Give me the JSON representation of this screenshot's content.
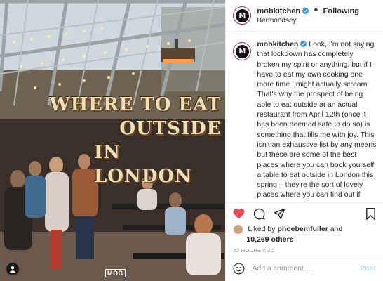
{
  "photo": {
    "headline": [
      "WHERE TO EAT",
      "OUTSIDE",
      "IN LONDON"
    ],
    "watermark": "MOB"
  },
  "header": {
    "username": "mobkitchen",
    "separator": "•",
    "follow_status": "Following",
    "location": "Bermondsey",
    "avatar_letter": "M"
  },
  "caption": {
    "username": "mobkitchen",
    "text": "Look, I'm not saying that lockdown has completely broken my spirit or anything, but if I have to eat my own cooking one more time I might actually scream. That's why the prospect of being able to eat outside at an actual restaurant from April 12th (once it has been deemed safe to do so) is something that fills me with joy. This isn't an exhaustive list by any means but these are some of the best places where you can book yourself a table to eat outside in London this spring – they're the sort of lovely places where you can find out if you've been cat-fished by your lockdown boo and finally meet your work colleagues face-to-face over a plate of freshly-made pappardelle. Hit the link in bio for"
  },
  "likes": {
    "prefix": "Liked by",
    "user": "phoebemfuller",
    "and": "and",
    "others": "10,269 others"
  },
  "timestamp": "22 HOURS AGO",
  "comment": {
    "placeholder": "Add a comment…",
    "post_label": "Post"
  },
  "colors": {
    "heart": "#ed4956",
    "link": "#3897f0",
    "post_disabled": "#b3dbff",
    "headline": "#f2dfb6"
  }
}
